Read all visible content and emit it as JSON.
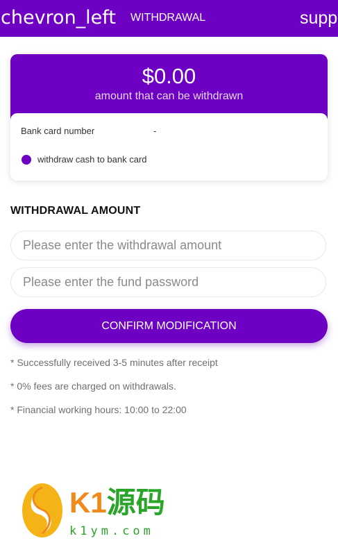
{
  "header": {
    "back_icon_text": "chevron_left",
    "title": "WITHDRAWAL",
    "support_label": "supp"
  },
  "balance": {
    "amount": "$0.00",
    "caption": "amount that can be withdrawn"
  },
  "bank": {
    "card_label": "Bank card number",
    "card_value": "-",
    "method_label": "withdraw cash to bank card"
  },
  "form": {
    "section_title": "WITHDRAWAL AMOUNT",
    "amount_placeholder": "Please enter the withdrawal amount",
    "password_placeholder": "Please enter the fund password",
    "confirm_label": "CONFIRM MODIFICATION"
  },
  "notes": [
    "* Successfully received 3-5 minutes after receipt",
    "* 0% fees are charged on withdrawals.",
    "* Financial working hours: 10:00 to 22:00"
  ],
  "watermark": {
    "brand_k1": "K1",
    "brand_cn": "源码",
    "url": "k1ym.com"
  },
  "colors": {
    "accent": "#6d00c2",
    "brand_orange": "#f08a1c",
    "brand_green": "#2aa52a"
  }
}
